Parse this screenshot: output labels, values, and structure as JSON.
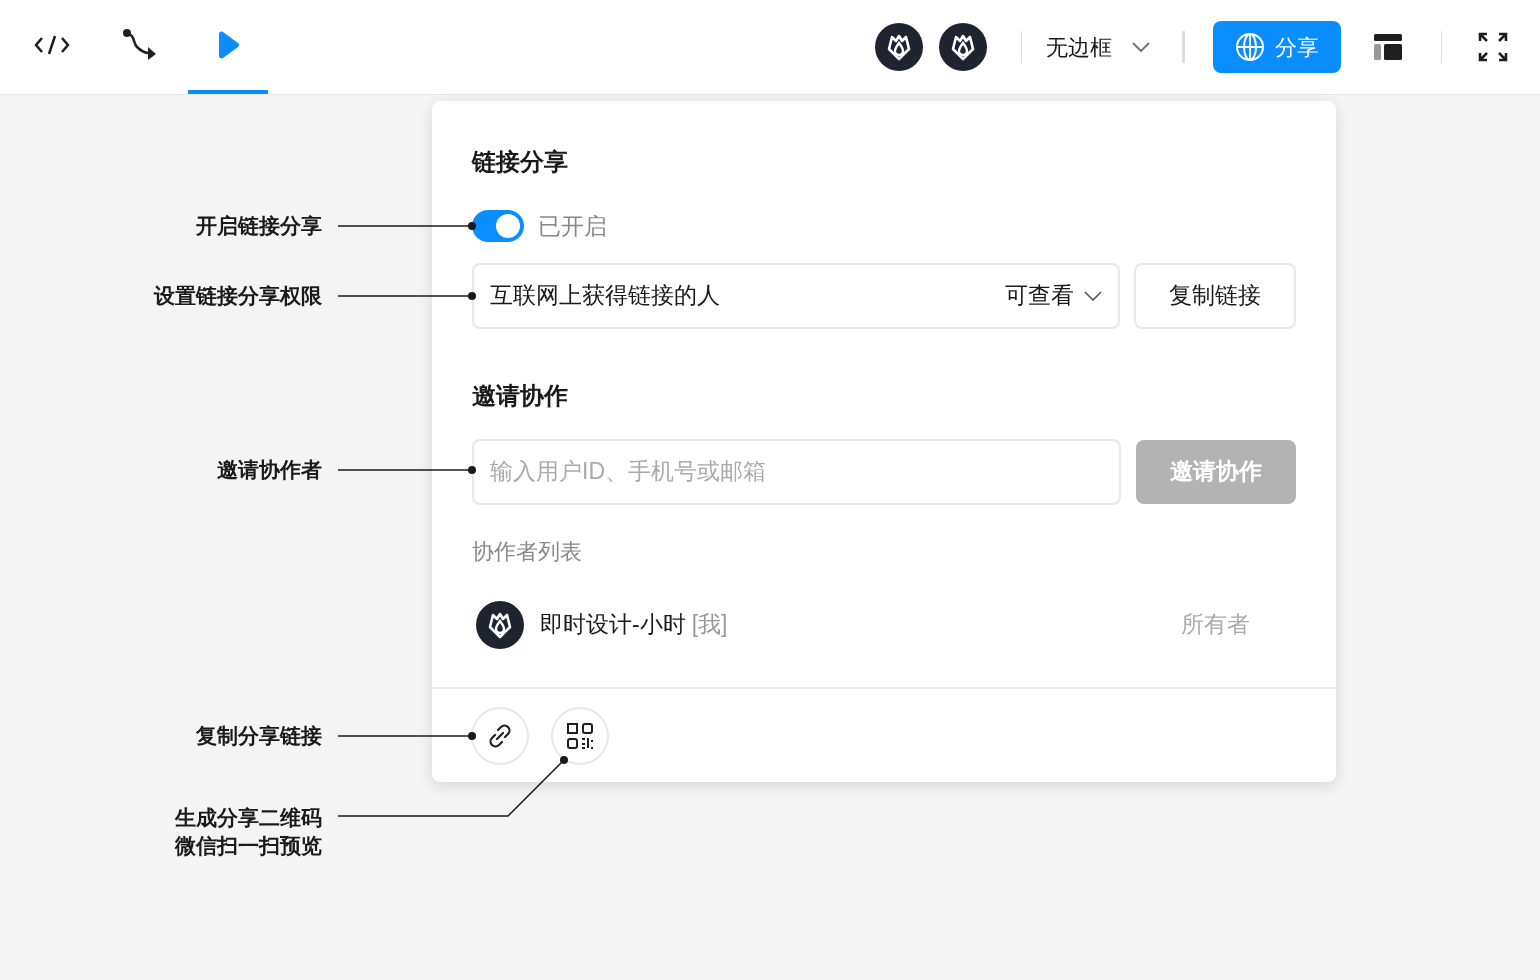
{
  "toolbar": {
    "tabs": [
      {
        "kind": "code",
        "selected": false
      },
      {
        "kind": "flow",
        "selected": false
      },
      {
        "kind": "play",
        "selected": true
      }
    ],
    "frame_select": {
      "value": "无边框"
    },
    "share_button": "分享"
  },
  "share_panel": {
    "title": "链接分享",
    "link_sharing": {
      "on": true,
      "status": "已开启"
    },
    "audience": "互联网上获得链接的人",
    "permission": "可查看",
    "copy_button": "复制链接",
    "invite_title": "邀请协作",
    "invite_field": {
      "placeholder": "输入用户ID、手机号或邮箱"
    },
    "invite_button": {
      "label": "邀请协作",
      "disabled": true
    },
    "collaborators_label": "协作者列表",
    "collaborators": [
      {
        "name": "即时设计-小时",
        "tag": "[我]",
        "role": "所有者"
      }
    ]
  },
  "annotations": [
    {
      "lines": [
        "开启链接分享"
      ]
    },
    {
      "lines": [
        "设置链接分享权限"
      ]
    },
    {
      "lines": [
        "邀请协作者"
      ]
    },
    {
      "lines": [
        "复制分享链接"
      ]
    },
    {
      "lines": [
        "生成分享二维码",
        "微信扫一扫预览"
      ]
    }
  ]
}
